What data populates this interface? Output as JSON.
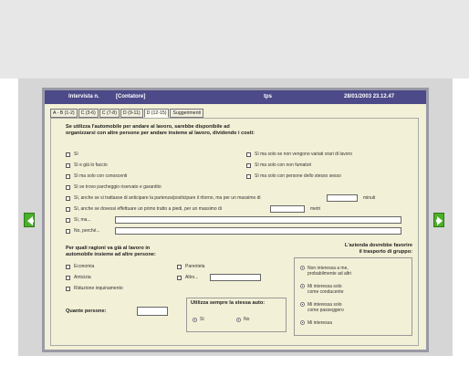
{
  "window": {
    "interview_label": "Intervista n.",
    "counter_label": "[Contatore]",
    "app_code": "tps",
    "datetime": "28/01/2003 23.12.47"
  },
  "tabs": [
    {
      "label": "A - B (1-2)",
      "active": false
    },
    {
      "label": "C (3-6)",
      "active": false
    },
    {
      "label": "C (7-8)",
      "active": false
    },
    {
      "label": "D (9-11)",
      "active": false
    },
    {
      "label": "D (12-15)",
      "active": true
    },
    {
      "label": "Suggerimenti",
      "active": false
    }
  ],
  "q1": {
    "text": "Se utilizza l'automobile per andare al lavoro, sarebbe disponibile ad\norganizzarsi con altre persone per andare insieme al lavoro, dividendo i costi:",
    "options_left": [
      "Sì",
      "Sì e già lo faccio",
      "Sì ma solo con conoscenti",
      "Sì se trovo parcheggio riservato e garantito"
    ],
    "options_right": [
      "Sì ma solo se non vengono variati orari di lavoro",
      "Sì ma solo con non fumatori",
      "Sì ma solo con persone dello stesso sesso"
    ],
    "anticipate_text": "Sì, anche se si trattasse di anticipare la partenza/posticipare il ritorno, ma per un massimo di",
    "anticipate_unit": "minuti",
    "walk_text": "Sì, anche se dovessi effettuare un primo tratto a piedi, per un massimo di",
    "walk_unit": "metri",
    "si_ma": "Sì, ma...",
    "no_perche": "No, perché..."
  },
  "q2": {
    "text": "Per quali ragioni va già al lavoro in\nautomobile insieme ad altre persone:",
    "options_col1": [
      "Economia",
      "Amicizia",
      "Riduzione inquinamento"
    ],
    "options_col2": [
      "Parentela",
      "Altro..."
    ]
  },
  "persons": {
    "label": "Quante persone:"
  },
  "always_same": {
    "label": "Utilizza sempre la stessa auto:",
    "options": [
      "Sì",
      "No"
    ]
  },
  "group_transport": {
    "title": "L'azienda dovrebbe favorire\nil trasporto di gruppo:",
    "options": [
      "Non interessa a me,\nprobabilmente ad altri",
      "Mi interessa solo\ncome conducente",
      "Mi interessa solo\ncome passeggero",
      "Mi interessa"
    ]
  },
  "nav": {
    "prev_icon": "arrow-left-icon",
    "next_icon": "arrow-right-icon",
    "color": "#4caf2a"
  }
}
